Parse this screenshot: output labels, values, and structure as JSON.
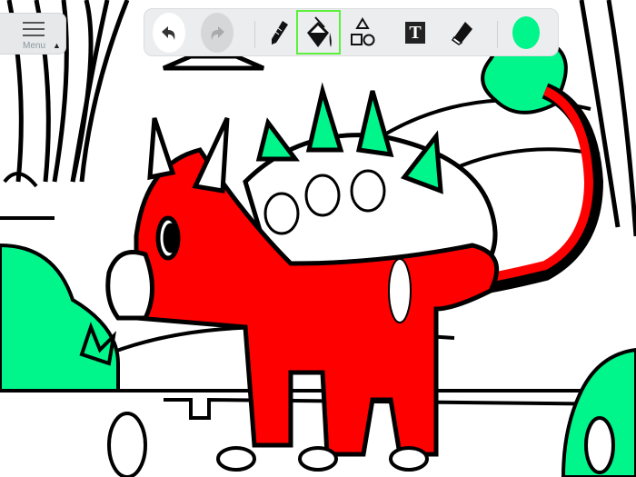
{
  "menu": {
    "label": "Menu",
    "icon": "hamburger-icon",
    "caret": "▲"
  },
  "toolbar": {
    "undo": "undo-icon",
    "redo": "redo-icon",
    "tools": [
      "pencil",
      "fill-bucket",
      "shapes",
      "text",
      "eraser"
    ],
    "selected_tool": "fill-bucket",
    "text_tool_glyph": "T",
    "current_color": "#00f58a"
  },
  "colors": {
    "red": "#ff0000",
    "green": "#00f58a",
    "selection": "#5af03c"
  }
}
